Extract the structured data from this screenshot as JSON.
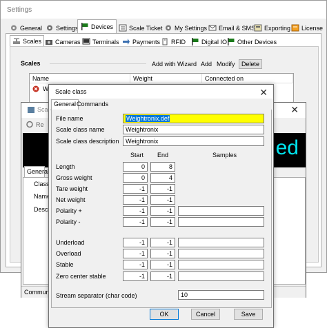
{
  "settings": {
    "title": "Settings",
    "tabs": [
      {
        "label": "General"
      },
      {
        "label": "Settings"
      },
      {
        "label": "Devices"
      },
      {
        "label": "Scale Ticket"
      },
      {
        "label": "My Settings"
      },
      {
        "label": "Email & SMS"
      },
      {
        "label": "Exporting"
      },
      {
        "label": "License"
      }
    ],
    "sub_tabs": [
      {
        "label": "Scales"
      },
      {
        "label": "Cameras"
      },
      {
        "label": "Terminals"
      },
      {
        "label": "Payments"
      },
      {
        "label": "RFID"
      },
      {
        "label": "Digital IO"
      },
      {
        "label": "Other Devices"
      }
    ],
    "scales": {
      "section_label": "Scales",
      "actions": {
        "add_with_wizard": "Add with Wizard",
        "add": "Add",
        "modify": "Modify",
        "delete": "Delete"
      },
      "columns": {
        "name": "Name",
        "weight": "Weight",
        "connected_on": "Connected on"
      },
      "row_name_partial": "We"
    }
  },
  "scale_window": {
    "title_partial": "Scale",
    "toolbar_partial": "Re",
    "display_partial": "ed",
    "tab_partial": "General",
    "fields": {
      "class": "Class",
      "name": "Name",
      "description": "Descri"
    },
    "status_partial": "Commun"
  },
  "dialog": {
    "title": "Scale class",
    "tabs": {
      "general": "General",
      "commands": "Commands"
    },
    "file_name_label": "File name",
    "file_name_value": "Weightronix.def",
    "class_name_label": "Scale class name",
    "class_name_value": "Weightronix",
    "class_desc_label": "Scale class description",
    "class_desc_value": "Weightronix",
    "col_start": "Start",
    "col_end": "End",
    "col_samples": "Samples",
    "rows": [
      {
        "label": "Length",
        "start": "0",
        "end": "8"
      },
      {
        "label": "Gross weight",
        "start": "0",
        "end": "4"
      },
      {
        "label": "Tare weight",
        "start": "-1",
        "end": "-1"
      },
      {
        "label": "Net weight",
        "start": "-1",
        "end": "-1"
      },
      {
        "label": "Polarity +",
        "start": "-1",
        "end": "-1",
        "samples": ""
      },
      {
        "label": "Polarity -",
        "start": "-1",
        "end": "-1",
        "samples": ""
      },
      {
        "label": "Underload",
        "start": "-1",
        "end": "-1",
        "samples": ""
      },
      {
        "label": "Overload",
        "start": "-1",
        "end": "-1",
        "samples": ""
      },
      {
        "label": "Stable",
        "start": "-1",
        "end": "-1",
        "samples": ""
      },
      {
        "label": "Zero center stable",
        "start": "-1",
        "end": "-1",
        "samples": ""
      }
    ],
    "stream_sep_label": "Stream separator (char code)",
    "stream_sep_value": "10",
    "buttons": {
      "ok": "OK",
      "cancel": "Cancel",
      "save": "Save"
    }
  },
  "colors": {
    "highlight": "#ffff00",
    "selection": "#0078d7",
    "display_bg": "#000000",
    "display_text": "#00e6f0"
  }
}
